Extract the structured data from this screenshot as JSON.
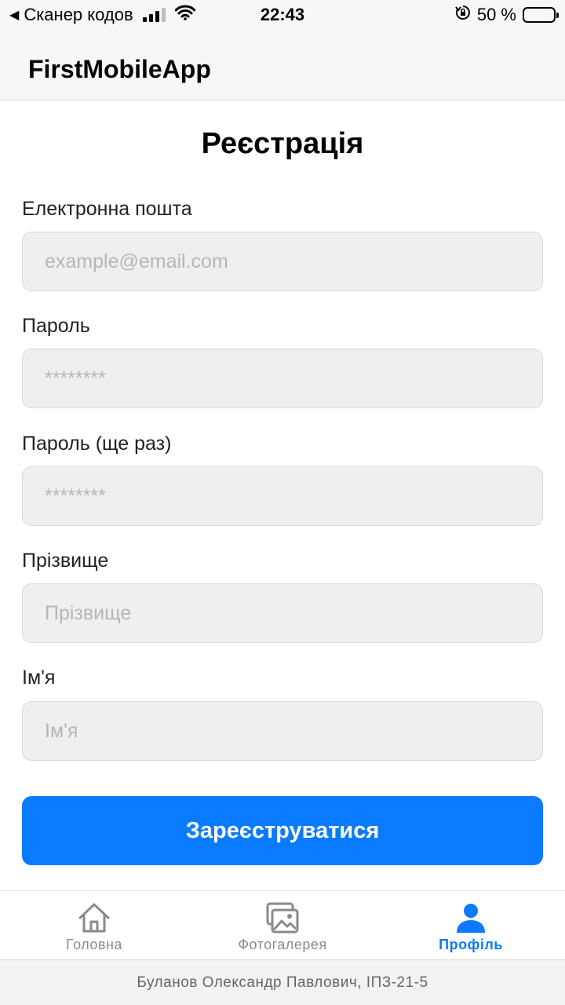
{
  "status_bar": {
    "back_label": "Сканер кодов",
    "time": "22:43",
    "battery_percent": "50 %",
    "battery_level": 0.5
  },
  "header": {
    "title": "FirstMobileApp"
  },
  "form": {
    "title": "Реєстрація",
    "fields": [
      {
        "label": "Електронна пошта",
        "placeholder": "example@email.com"
      },
      {
        "label": "Пароль",
        "placeholder": "********"
      },
      {
        "label": "Пароль (ще раз)",
        "placeholder": "********"
      },
      {
        "label": "Прізвище",
        "placeholder": "Прізвище"
      },
      {
        "label": "Ім'я",
        "placeholder": "Ім'я"
      }
    ],
    "submit_label": "Зареєструватися"
  },
  "tabs": [
    {
      "label": "Головна",
      "icon": "home-icon",
      "active": false
    },
    {
      "label": "Фотогалерея",
      "icon": "gallery-icon",
      "active": false
    },
    {
      "label": "Профіль",
      "icon": "person-icon",
      "active": true
    }
  ],
  "footer": {
    "text": "Буланов Олександр Павлович, ІПЗ-21-5"
  },
  "colors": {
    "accent": "#0a7bff",
    "inactive_tab": "#8a8a8a"
  }
}
